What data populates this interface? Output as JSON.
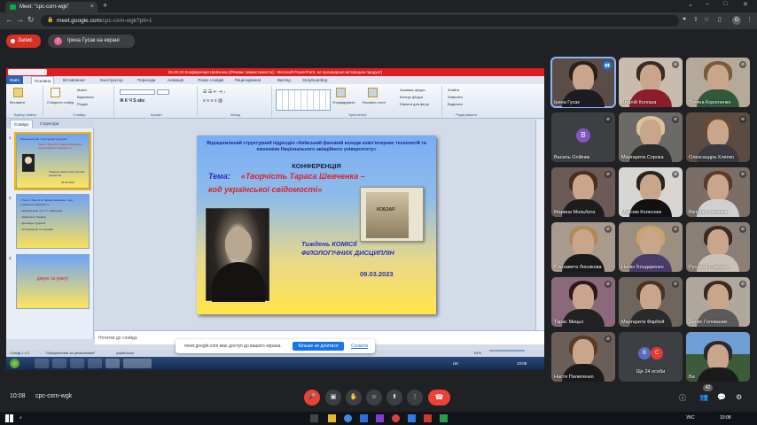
{
  "browser": {
    "tab_title": "Meet: \"cpc-cxrn-wgk\"",
    "tab_close": "×",
    "new_tab": "+",
    "url_host": "meet.google.com",
    "url_path": "/cpc-cxrn-wgk?pli=1",
    "window_controls": [
      "⌄",
      "–",
      "□",
      "✕"
    ],
    "nav": [
      "←",
      "→",
      "↻"
    ],
    "profile_letter": "G"
  },
  "meet_top": {
    "record_label": "Запис",
    "presenting_label": "Ірина Гусак на екрані",
    "presenter_initial": "І"
  },
  "powerpoint": {
    "title": "09.03.23 Конференція Шевченко [Режим совместимости] - Microsoft PowerPoint, не прошедшая активацию продукт)",
    "tabs": [
      "Файл",
      "Основна",
      "Вставлення",
      "Конструктор",
      "Переходи",
      "Анімація",
      "Показ слайдів",
      "Рецензування",
      "Вигляд",
      "Storyboarding"
    ],
    "ribbon_groups": [
      "Буфер обміну",
      "Слайди",
      "Шрифт",
      "Абзац",
      "Креслення",
      "Редагування"
    ],
    "ribbon_buttons": {
      "paste": "Вставити",
      "new_slide": "Створити слайд",
      "layout": "Макет",
      "reset": "Відновити",
      "section": "Розділ",
      "arrange": "Упорядкувати",
      "quick_styles": "Експрес-стилі",
      "shape_fill": "Заливка фігури",
      "shape_outline": "Контур фігури",
      "shape_effects": "Ефекти для фігур",
      "find": "Знайти",
      "replace": "Замінити",
      "select": "Виділити"
    },
    "pane_tabs": [
      "Слайди",
      "Структура"
    ],
    "thumbnails": [
      {
        "num": "1",
        "title_line": "Відокремлений структурний підрозділ",
        "theme": "Тема: «Творчість Тараса Шевченка – код української свідомості»",
        "week": "Тиждень комісії філологічних дисциплін",
        "date": "09.03.2023"
      },
      {
        "num": "2",
        "lines": [
          "• Тема: «Творчість Тараса Шевченка – код",
          "  української свідомості»",
          "• Цікавий факт про Т. Г. Шевченка",
          "• Шевченко і Україна",
          "• Доповідь студентів",
          "• Обговорення та підсумки"
        ]
      },
      {
        "num": "3",
        "text": "дякую за увагу!"
      }
    ],
    "slide": {
      "header": "Відокремлений структурний підрозділ «Київський фаховий коледж комп'ютерних технологій та економіки Національного авіаційного університету»",
      "conference": "КОНФЕРЕНЦІЯ",
      "tema_label": "Тема:",
      "theme_line1": "«Творчість   Тараса Шевченка –",
      "theme_line2": "код української свідомості»",
      "book_title": "КОБЗАР",
      "week_line1": "Тиждень КОМІСІЇ",
      "week_line2": "ФІЛОЛОГІЧНИХ ДИСЦИПЛІН",
      "date": "09.03.2023"
    },
    "notes_placeholder": "Нотатки до слайда",
    "status": {
      "slide_info": "Слайд 1 з 3",
      "theme": "\"Оформлення за умовчанням\"",
      "lang": "українська",
      "zoom": "64%"
    },
    "win_taskbar": {
      "lang": "UK",
      "time": "10:08"
    }
  },
  "share_notice": {
    "text": "meet.google.com має доступ до вашого екрана.",
    "stop": "Більше не ділитися",
    "hide": "Сховати"
  },
  "participants": [
    {
      "name": "Ірина Гусак",
      "speaking": true
    },
    {
      "name": "Віталій Колоша"
    },
    {
      "name": "Тетяна Корніленко"
    },
    {
      "name": "Василь Олійник",
      "initial": "В",
      "color": "#7e57c2"
    },
    {
      "name": "Маргарита Сорока"
    },
    {
      "name": "Олександра Хлипко"
    },
    {
      "name": "Марина Мольбога"
    },
    {
      "name": "Максим Колесник"
    },
    {
      "name": "Вікторія Антонюк"
    },
    {
      "name": "Єлизавета Люсикова"
    },
    {
      "name": "Натан Бондаренко"
    },
    {
      "name": "Руслана Старунь"
    },
    {
      "name": "Тарас Мицьо"
    },
    {
      "name": "Маргарита Фарбей"
    },
    {
      "name": "Денис Голованик"
    },
    {
      "name": "Настя Пилипенко"
    },
    {
      "name": "Ще 24 особи",
      "initials": [
        "В",
        "С"
      ]
    },
    {
      "name": "Ви"
    }
  ],
  "meet_bottom": {
    "time": "10:08",
    "code": "cpc-cxrn-wgk",
    "controls": [
      "🎤",
      "▣",
      "✋",
      "☺",
      "⬆",
      "⋮"
    ],
    "hangup": "☎",
    "right_icons": [
      "ⓘ",
      "👥",
      "💬",
      "⚙"
    ],
    "people_count": "42"
  },
  "win10": {
    "search_icon": "⌕",
    "tray_lang": "УКС",
    "tray_time": "10:08"
  },
  "colors": {
    "meet_bg": "#202124",
    "record_red": "#d93025",
    "accent_blue": "#1a73e8",
    "hangup_red": "#ea4335"
  }
}
